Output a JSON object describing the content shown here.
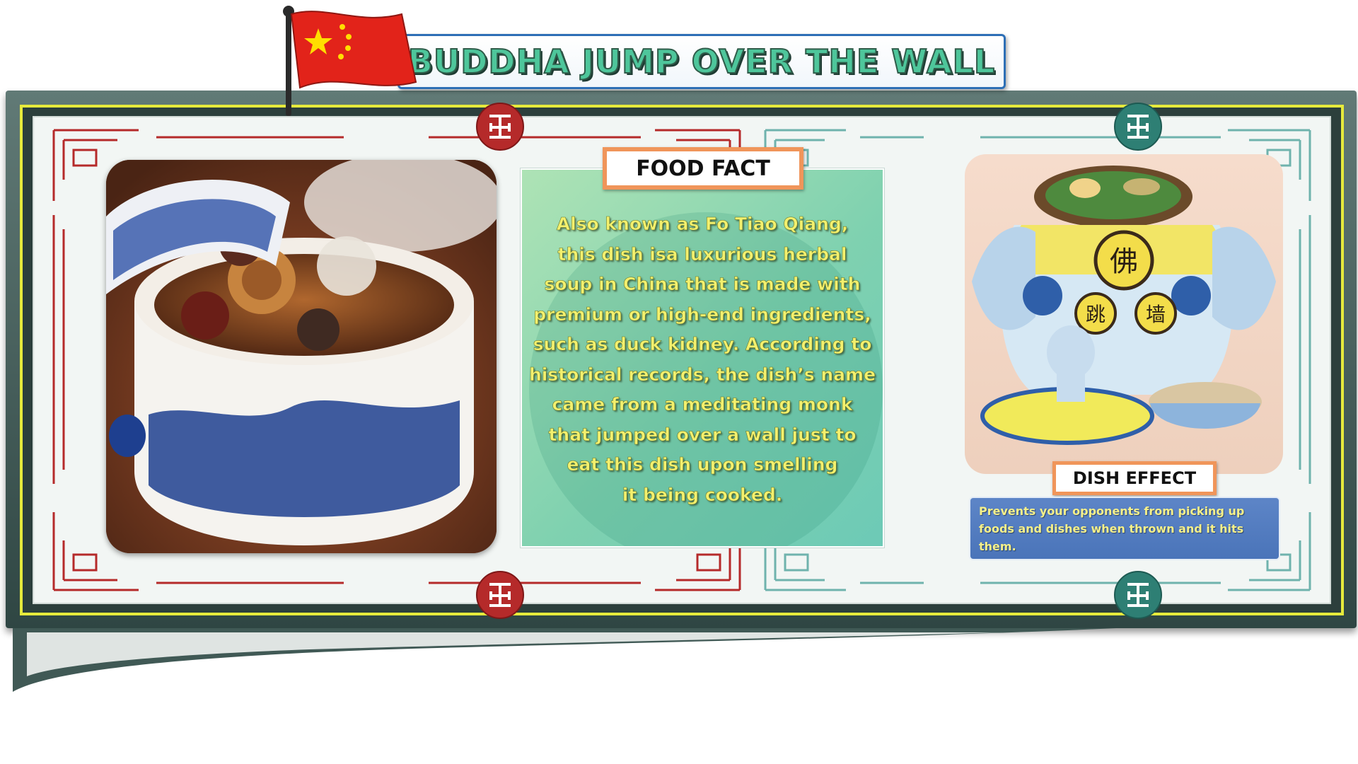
{
  "title": "BUDDHA JUMP OVER THE WALL",
  "flag": {
    "name": "china-flag-icon",
    "red": "#e2231a",
    "star": "#ffde00"
  },
  "food_fact": {
    "label": "FOOD FACT",
    "lines": [
      "Also known as Fo Tiao Qiang,",
      "this dish isa luxurious herbal",
      "soup in China that is made with",
      "premium or high-end ingredients,",
      "such as duck kidney. According to",
      "historical records, the dish’s name",
      "came from a meditating monk",
      "that jumped over a wall just to",
      "eat this dish upon smelling",
      "it being cooked."
    ]
  },
  "dish_effect": {
    "label": "DISH EFFECT",
    "text": "Prevents your opponents from picking up foods and dishes when thrown and it hits them."
  },
  "dish_chars": [
    "佛",
    "跳",
    "墙"
  ],
  "colors": {
    "frame": "#2f4643",
    "frame_inner": "#e6ea3c",
    "panel": "#f2f6f4",
    "label_border": "#f0955a",
    "fact_text": "#f3f06e",
    "effect_bg": "#4f79bd",
    "ornament_red": "#b52a2a",
    "ornament_teal": "#2e7f74"
  }
}
